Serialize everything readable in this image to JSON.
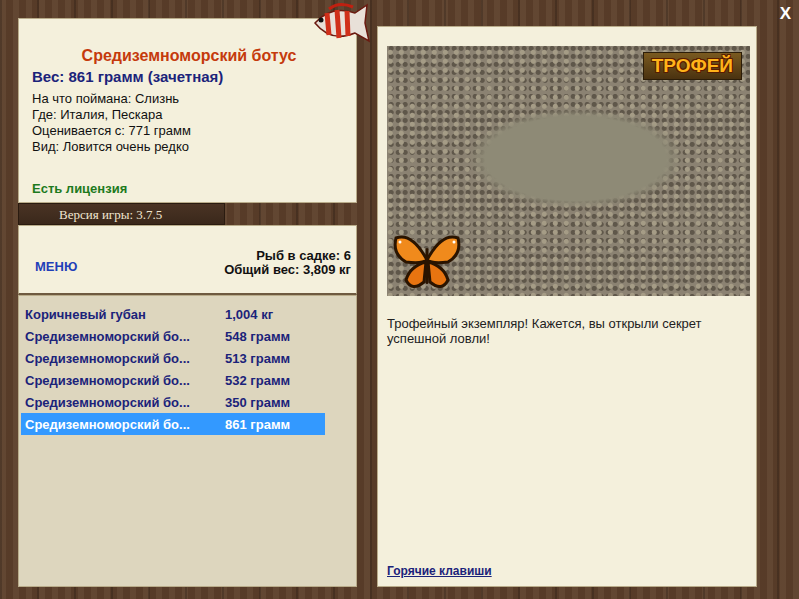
{
  "close": "X",
  "fish": {
    "name": "Средиземноморский ботус",
    "weight": "Вес: 861 грамм (зачетная)",
    "details": [
      "На что поймана: Слизнь",
      "Где: Италия, Пескара",
      "Оценивается с: 771 грамм",
      "Вид: Ловится очень редко"
    ],
    "license": "Есть лицензия"
  },
  "version": "Версия игры: 3.7.5",
  "menu": "МЕНЮ",
  "keepnet": {
    "count": "Рыб в садке: 6",
    "total": "Общий вес: 3,809 кг"
  },
  "catch_list": [
    {
      "name": "Коричневый губан",
      "weight": "1,004 кг",
      "selected": false
    },
    {
      "name": "Средиземноморский бо...",
      "weight": "548 грамм",
      "selected": false
    },
    {
      "name": "Средиземноморский бо...",
      "weight": "513 грамм",
      "selected": false
    },
    {
      "name": "Средиземноморский бо...",
      "weight": "532 грамм",
      "selected": false
    },
    {
      "name": "Средиземноморский бо...",
      "weight": "350 грамм",
      "selected": false
    },
    {
      "name": "Средиземноморский бо...",
      "weight": "861 грамм",
      "selected": true
    }
  ],
  "trophy_badge": "ТРОФЕЙ",
  "message": "Трофейный экземпляр! Кажется, вы открыли секрет успешной ловли!",
  "hotkeys": "Горячие клавиши"
}
